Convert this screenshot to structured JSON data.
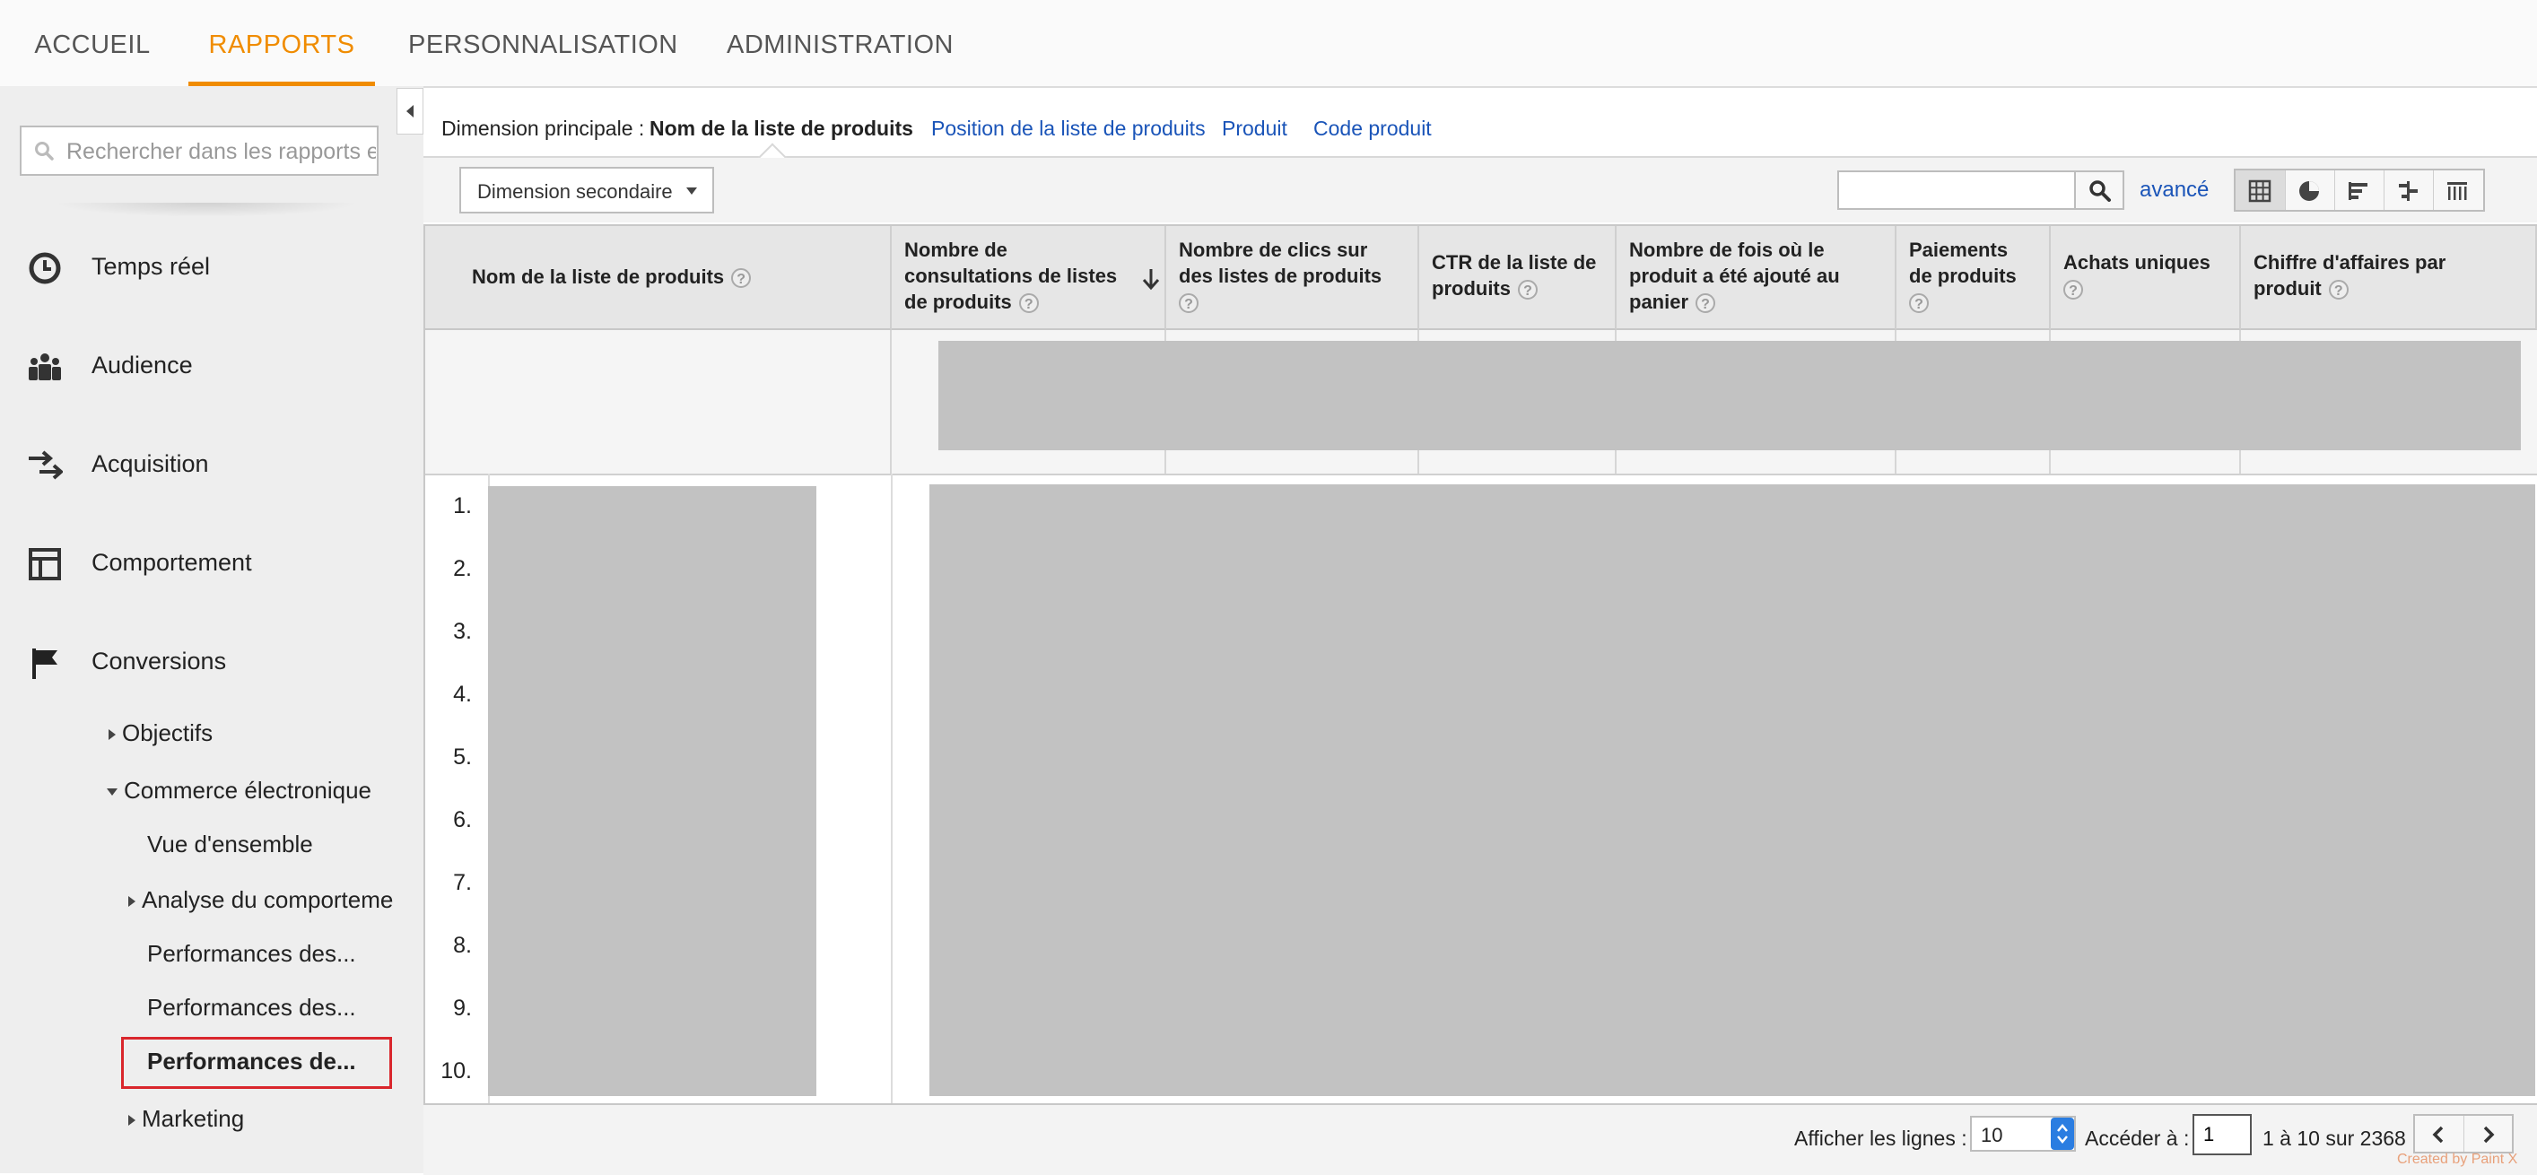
{
  "topnav": {
    "tabs": [
      {
        "label": "ACCUEIL"
      },
      {
        "label": "RAPPORTS"
      },
      {
        "label": "PERSONNALISATION"
      },
      {
        "label": "ADMINISTRATION"
      }
    ],
    "active_color": "#f08c00"
  },
  "sidebar": {
    "search_placeholder": "Rechercher dans les rapports et",
    "items": [
      {
        "label": "Temps réel",
        "icon": "clock-icon"
      },
      {
        "label": "Audience",
        "icon": "people-icon"
      },
      {
        "label": "Acquisition",
        "icon": "arrows-icon"
      },
      {
        "label": "Comportement",
        "icon": "layout-icon"
      },
      {
        "label": "Conversions",
        "icon": "flag-icon"
      }
    ],
    "sub": {
      "objectifs": "Objectifs",
      "ecommerce": "Commerce électronique",
      "vue": "Vue d'ensemble",
      "analyse": "Analyse du comporteme",
      "perf1": "Performances des...",
      "perf2": "Performances des...",
      "perf3": "Performances de...",
      "marketing": "Marketing"
    },
    "highlight_color": "#d9262c"
  },
  "dimbar": {
    "label": "Dimension principale :",
    "current": "Nom de la liste de produits",
    "links": [
      "Position de la liste de produits",
      "Produit",
      "Code produit"
    ]
  },
  "toolbar": {
    "secondary": "Dimension secondaire",
    "advanced": "avancé"
  },
  "table": {
    "headers": [
      "Nom de la liste de produits",
      "Nombre de consultations de listes de produits",
      "Nombre de clics sur des listes de produits",
      "CTR de la liste de produits",
      "Nombre de fois où le produit a été ajouté au panier",
      "Paiements de produits",
      "Achats uniques",
      "Chiffre d'affaires par produit"
    ],
    "header_lines": {
      "h1": [
        "Nombre de",
        "consultations de listes",
        "de produits"
      ],
      "h2": [
        "Nombre de clics sur",
        "des listes de produits"
      ],
      "h3": [
        "CTR de la liste de",
        "produits"
      ],
      "h4": [
        "Nombre de fois où le",
        "produit a été ajouté au",
        "panier"
      ],
      "h5": [
        "Paiements",
        "de produits"
      ],
      "h6": [
        "Achats uniques"
      ],
      "h7": [
        "Chiffre d'affaires par",
        "produit"
      ]
    },
    "help": "?",
    "rows": [
      "1.",
      "2.",
      "3.",
      "4.",
      "5.",
      "6.",
      "7.",
      "8.",
      "9.",
      "10."
    ]
  },
  "footer": {
    "rows_label": "Afficher les lignes :",
    "rows_value": "10",
    "goto_label": "Accéder à :",
    "goto_value": "1",
    "range": "1 à 10 sur 2368"
  },
  "watermark": "Created by Paint X"
}
